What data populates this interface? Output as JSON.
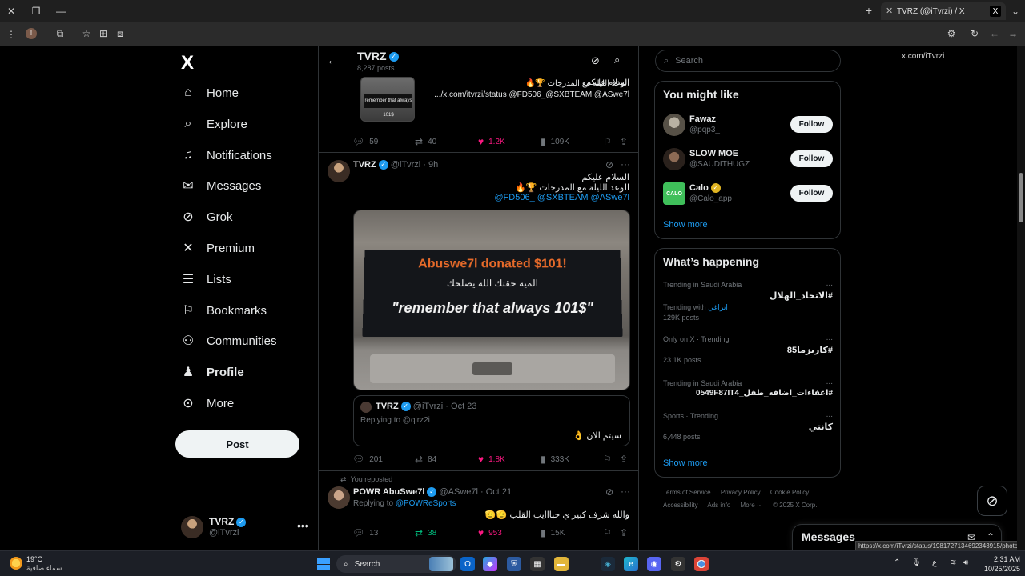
{
  "browser": {
    "tab_title": "TVRZ (@iTvrzi) / X",
    "tab_favicon": "X",
    "url": "x.com/iTvrzi"
  },
  "nav": {
    "logo": "X",
    "items": [
      {
        "label": "Home",
        "icon": "home-icon"
      },
      {
        "label": "Explore",
        "icon": "search-icon"
      },
      {
        "label": "Notifications",
        "icon": "bell-icon"
      },
      {
        "label": "Messages",
        "icon": "mail-icon"
      },
      {
        "label": "Grok",
        "icon": "grok-icon"
      },
      {
        "label": "Premium",
        "icon": "x-icon"
      },
      {
        "label": "Lists",
        "icon": "list-icon"
      },
      {
        "label": "Bookmarks",
        "icon": "bookmark-icon"
      },
      {
        "label": "Communities",
        "icon": "people-icon"
      },
      {
        "label": "Profile",
        "icon": "person-icon"
      },
      {
        "label": "More",
        "icon": "more-circle-icon"
      }
    ],
    "post_label": "Post",
    "account": {
      "name": "TVRZ",
      "handle": "@iTvrzi",
      "more": "•••"
    }
  },
  "header": {
    "title": "TVRZ",
    "post_count": "8,287 posts"
  },
  "tweet1": {
    "line1": "السلام عليكم",
    "line2": "الوعد الليلة مع المدرجات 🏆🔥",
    "line3": ".../x.com/itvrzi/status @FD506_@SXBTEAM @ASwe7l",
    "thumb_text": "remember that always 101$",
    "replies": "59",
    "reposts": "40",
    "likes": "1.2K",
    "views": "109K"
  },
  "tweet2": {
    "name": "TVRZ",
    "handle": "@iTvrzi · 9h",
    "line1": "السلام عليكم",
    "line2": "الوعد الليلة مع المدرجات 🏆🔥",
    "mentions": "@FD506_ @SXBTEAM @ASwe7l",
    "image": {
      "l1": "Abuswe7l donated $101!",
      "l2": "الميه حقتك الله يصلحك",
      "l3": "\"remember that always 101$\""
    },
    "quote": {
      "name": "TVRZ",
      "handle": "@iTvrzi · Oct 23",
      "replying": "Replying to @qirz2i",
      "text": "سيتم الان 👌"
    },
    "replies": "201",
    "reposts": "84",
    "likes": "1.8K",
    "views": "333K"
  },
  "tweet3": {
    "repost_label": "You reposted",
    "name": "POWR AbuSwe7l",
    "handle": "@ASwe7l · Oct 21",
    "replying_prefix": "Replying to ",
    "replying_to": "@POWReSports",
    "text": "والله شرف كبير ي حبااايب القلب 🫡🫡",
    "replies": "13",
    "reposts": "38",
    "likes": "953",
    "views": "15K"
  },
  "sidebar": {
    "search_placeholder": "Search",
    "might_like_title": "You might like",
    "suggestions": [
      {
        "name": "Fawaz",
        "handle": "@pqp3_",
        "button": "Follow"
      },
      {
        "name": "SLOW MOE",
        "handle": "@SAUDITHUGZ",
        "button": "Follow"
      },
      {
        "name": "Calo",
        "handle": "@Calo_app",
        "button": "Follow",
        "avatar_text": "CALO"
      }
    ],
    "show_more": "Show more",
    "happening_title": "What’s happening",
    "trends": [
      {
        "context": "Trending in Saudi Arabia",
        "topic": "#الاتحاد_الهلال",
        "posts": "",
        "more": "..."
      },
      {
        "context": "Trending with",
        "context_link": "اتراغي",
        "topic": "",
        "posts": "129K posts",
        "more": ""
      },
      {
        "context": "Only on X · Trending",
        "topic": "#كاريزما85",
        "posts": "23.1K posts",
        "more": "..."
      },
      {
        "context": "Trending in Saudi Arabia",
        "topic": "#اعفاءات_اضافه_طفل_0549F87IT4",
        "posts": "",
        "more": "..."
      },
      {
        "context": "Sports · Trending",
        "topic": "كانتي",
        "posts": "6,448 posts",
        "more": "..."
      }
    ],
    "footer_row1": [
      "Terms of Service",
      "Privacy Policy",
      "Cookie Policy"
    ],
    "footer_row2": [
      "Accessibility",
      "Ads info",
      "More ···",
      "© 2025 X Corp."
    ]
  },
  "messages_label": "Messages",
  "status_url": "https://x.com/iTvrzi/status/1981727134692343915/photo/1",
  "taskbar": {
    "temp": "19°C",
    "weather": "سماء صافية",
    "search": "Search",
    "lang": "ع",
    "time": "2:31 AM",
    "date": "10/25/2025"
  }
}
